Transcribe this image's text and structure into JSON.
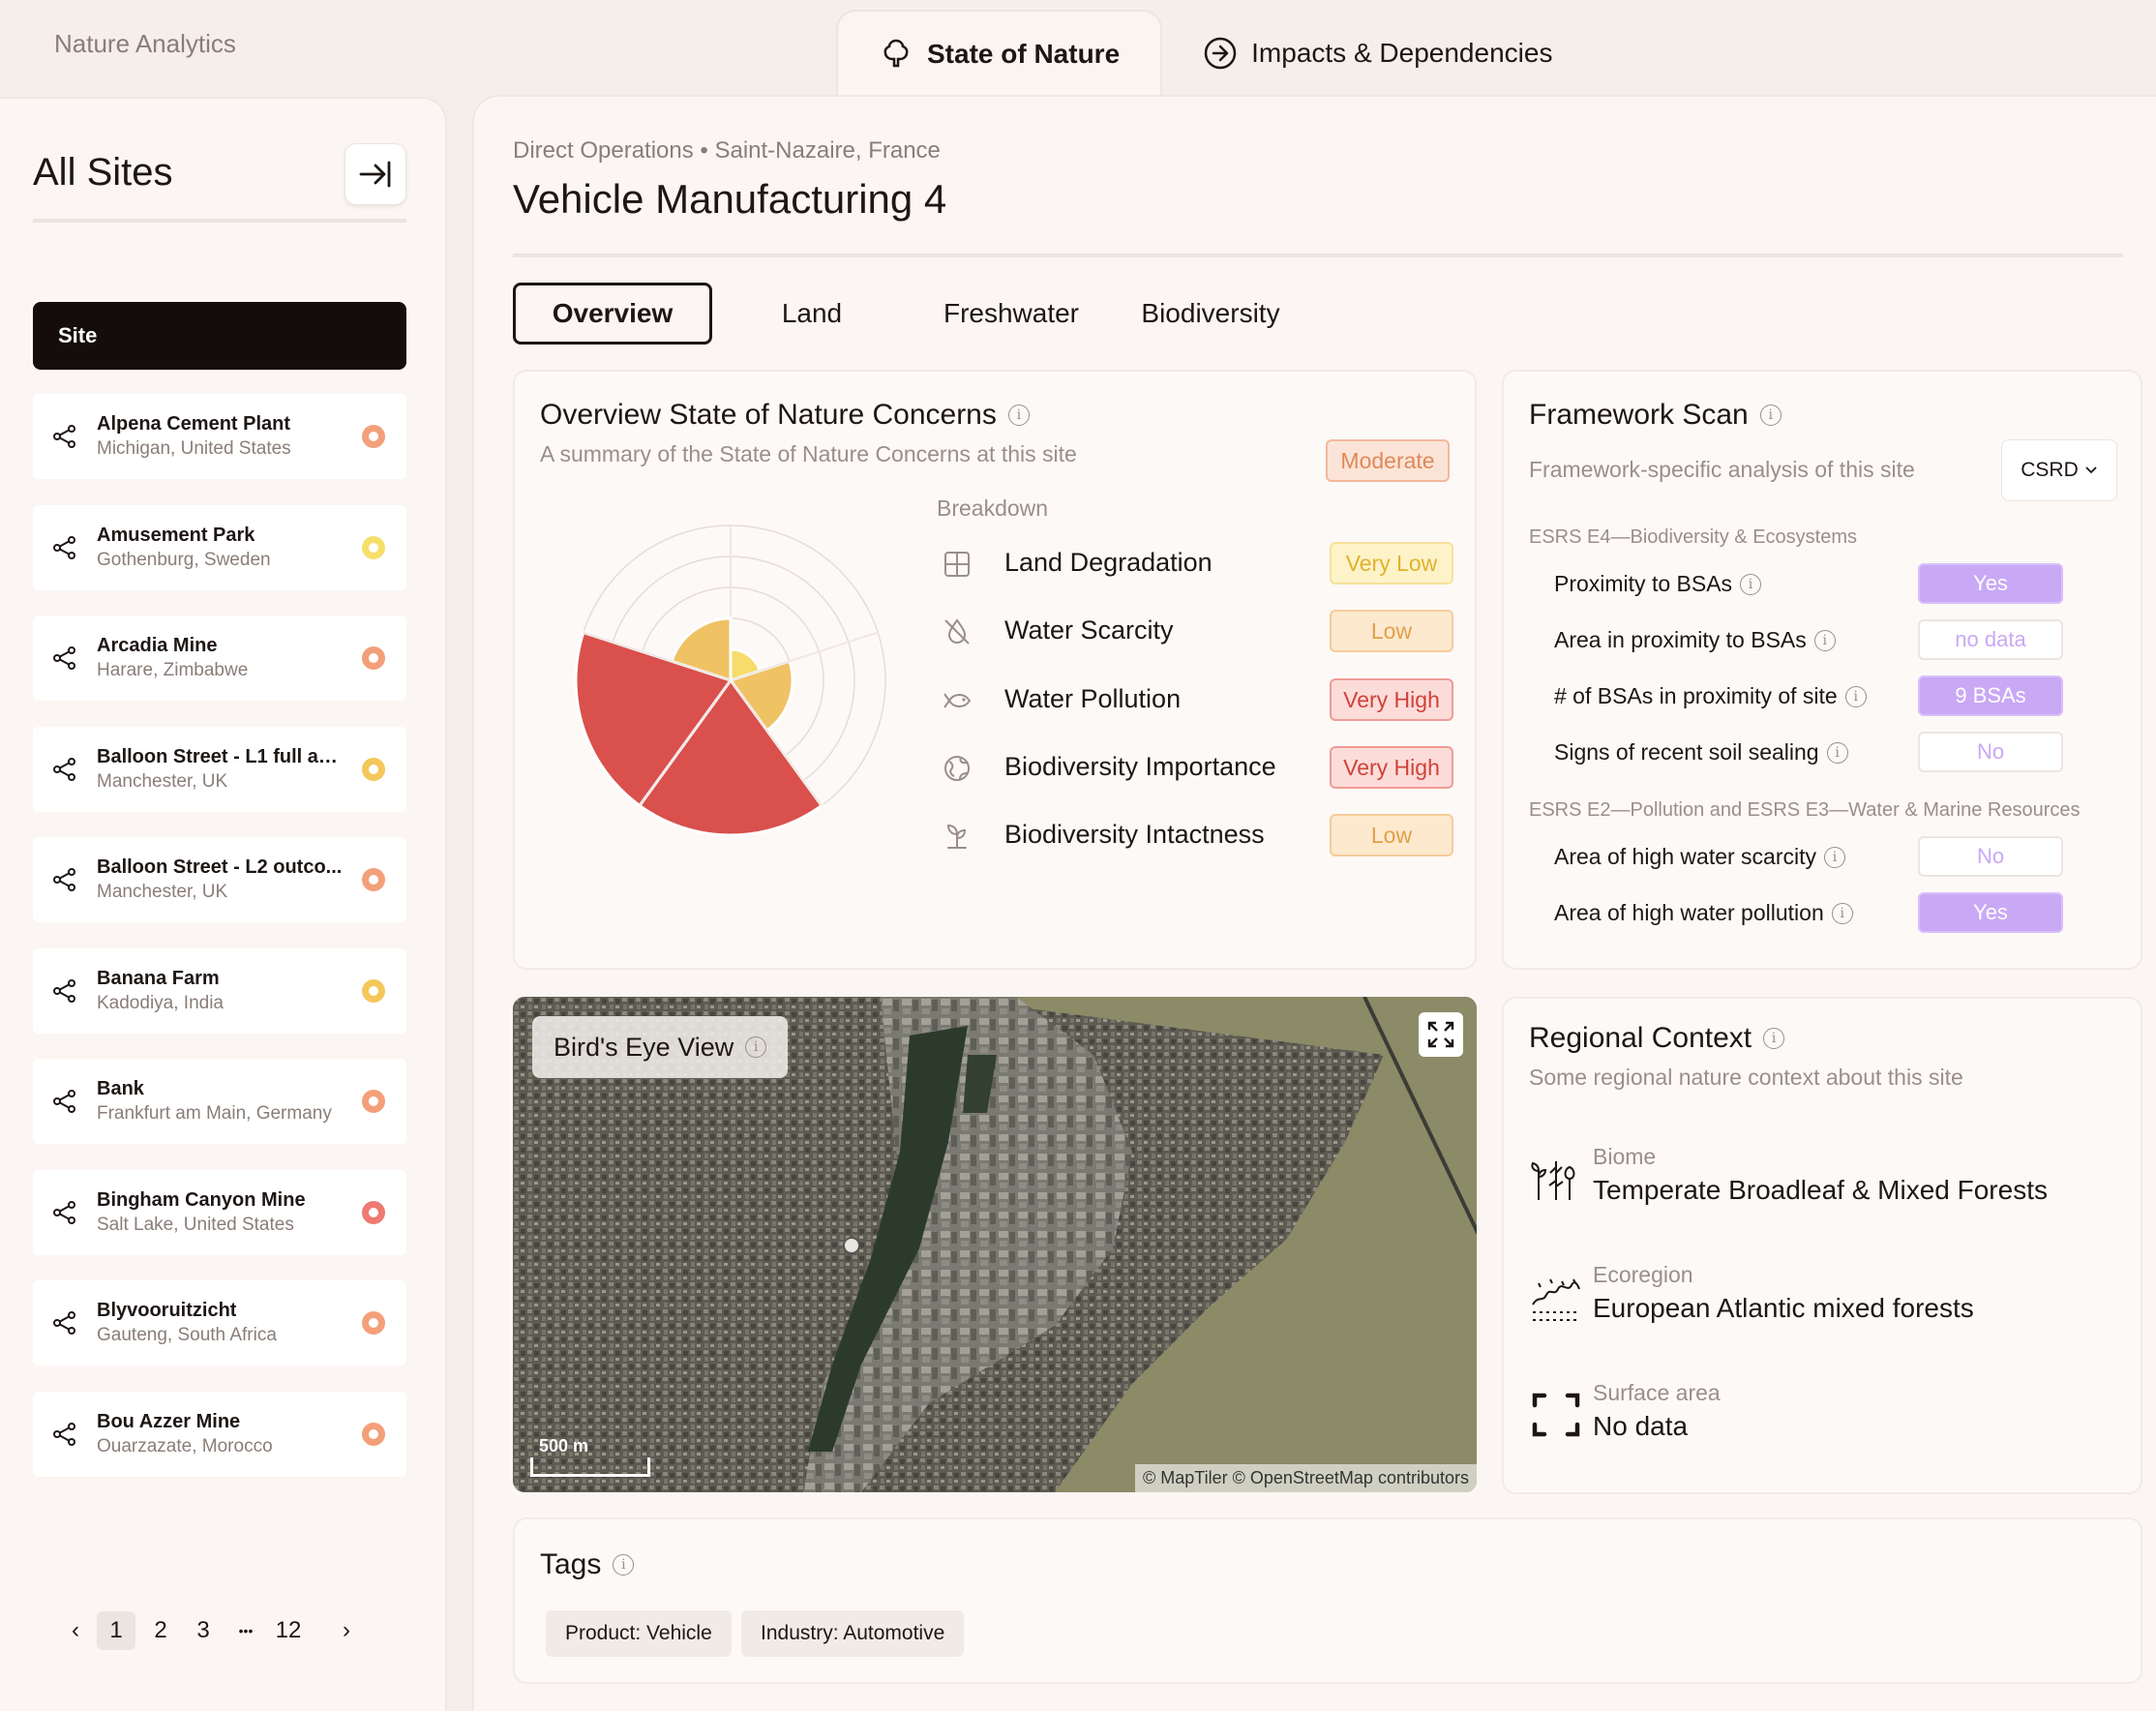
{
  "app_title": "Nature Analytics",
  "top_tabs": [
    {
      "label": "State of Nature",
      "icon": "tree-icon",
      "active": true
    },
    {
      "label": "Impacts & Dependencies",
      "icon": "arrow-circle-icon",
      "active": false
    }
  ],
  "sidebar": {
    "title": "All Sites",
    "header": "Site",
    "sites": [
      {
        "name": "Alpena Cement Plant",
        "location": "Michigan, United States",
        "status_color": "#f3a07a"
      },
      {
        "name": "Amusement Park",
        "location": "Gothenburg, Sweden",
        "status_color": "#f6df6a"
      },
      {
        "name": "Arcadia Mine",
        "location": "Harare, Zimbabwe",
        "status_color": "#f3a07a"
      },
      {
        "name": "Balloon Street - L1 full ad...",
        "location": "Manchester, UK",
        "status_color": "#f4c75a"
      },
      {
        "name": "Balloon Street - L2 outco...",
        "location": "Manchester, UK",
        "status_color": "#f3a07a"
      },
      {
        "name": "Banana Farm",
        "location": "Kadodiya, India",
        "status_color": "#f4c75a"
      },
      {
        "name": "Bank",
        "location": "Frankfurt am Main, Germany",
        "status_color": "#f3a07a"
      },
      {
        "name": "Bingham Canyon Mine",
        "location": "Salt Lake, United States",
        "status_color": "#ee7a72"
      },
      {
        "name": "Blyvooruitzicht",
        "location": "Gauteng, South Africa",
        "status_color": "#f3a07a"
      },
      {
        "name": "Bou Azzer Mine",
        "location": "Ouarzazate, Morocco",
        "status_color": "#f3a07a"
      }
    ],
    "pager": {
      "prev": "‹",
      "pages": [
        "1",
        "2",
        "3"
      ],
      "ellipsis": "•••",
      "last": "12",
      "next": "›",
      "current": "1"
    }
  },
  "main": {
    "breadcrumb": "Direct Operations • Saint-Nazaire, France",
    "title": "Vehicle Manufacturing 4",
    "tabs": [
      "Overview",
      "Land",
      "Freshwater",
      "Biodiversity"
    ],
    "active_tab": "Overview"
  },
  "overview": {
    "title": "Overview State of Nature Concerns",
    "subtitle": "A summary of the State of Nature Concerns at this site",
    "overall": "Moderate",
    "breakdown_label": "Breakdown",
    "rows": [
      {
        "name": "Land Degradation",
        "level": "Very Low",
        "icon": "grid-icon"
      },
      {
        "name": "Water Scarcity",
        "level": "Low",
        "icon": "water-drop-off-icon"
      },
      {
        "name": "Water Pollution",
        "level": "Very High",
        "icon": "fish-icon"
      },
      {
        "name": "Biodiversity Importance",
        "level": "Very High",
        "icon": "globe-leaf-icon"
      },
      {
        "name": "Biodiversity Intactness",
        "level": "Low",
        "icon": "plant-icon"
      }
    ],
    "radial_levels": [
      1,
      2,
      5,
      5,
      2
    ],
    "radial_max": 5
  },
  "framework": {
    "title": "Framework Scan",
    "subtitle": "Framework-specific analysis of this site",
    "selector": "CSRD",
    "sections": [
      {
        "title": "ESRS E4—Biodiversity & Ecosystems",
        "rows": [
          {
            "label": "Proximity to BSAs",
            "value": "Yes",
            "style": "yes"
          },
          {
            "label": "Area in proximity to BSAs",
            "value": "no data",
            "style": "white"
          },
          {
            "label": "# of BSAs in proximity of site",
            "value": "9 BSAs",
            "style": "yes"
          },
          {
            "label": "Signs of recent soil sealing",
            "value": "No",
            "style": "white"
          }
        ]
      },
      {
        "title": "ESRS E2—Pollution and ESRS E3—Water & Marine Resources",
        "rows": [
          {
            "label": "Area of high water scarcity",
            "value": "No",
            "style": "white"
          },
          {
            "label": "Area of high water pollution",
            "value": "Yes",
            "style": "yes"
          }
        ]
      }
    ]
  },
  "map": {
    "label": "Bird's Eye View",
    "scale": "500 m",
    "attribution": "© MapTiler © OpenStreetMap contributors"
  },
  "regional": {
    "title": "Regional Context",
    "subtitle": "Some regional nature context about this site",
    "items": [
      {
        "key": "Biome",
        "value": "Temperate Broadleaf & Mixed Forests",
        "icon": "biome-icon"
      },
      {
        "key": "Ecoregion",
        "value": "European Atlantic mixed forests",
        "icon": "ecoregion-icon"
      },
      {
        "key": "Surface area",
        "value": "No data",
        "icon": "area-frame-icon"
      }
    ]
  },
  "tags": {
    "title": "Tags",
    "items": [
      "Product: Vehicle",
      "Industry: Automotive"
    ]
  }
}
